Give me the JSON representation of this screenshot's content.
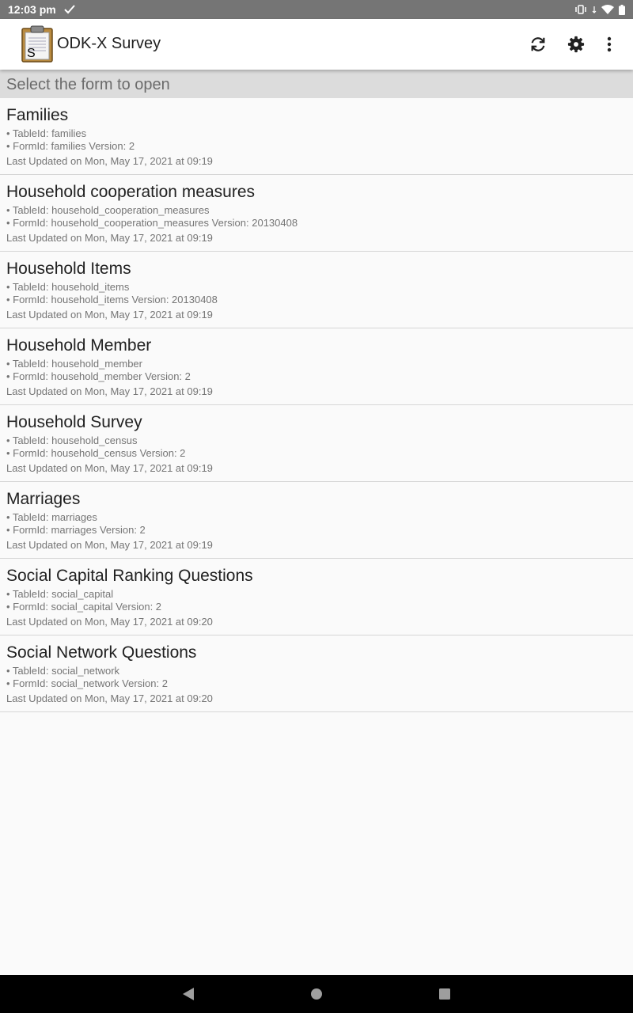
{
  "status": {
    "time": "12:03 pm"
  },
  "app": {
    "title": "ODK-X Survey",
    "logo_letter": "S"
  },
  "header": {
    "text": "Select the form to open"
  },
  "forms": [
    {
      "title": "Families",
      "table": "• TableId: families",
      "form": "• FormId: families Version: 2",
      "updated": "Last Updated on Mon, May 17, 2021 at 09:19"
    },
    {
      "title": "Household cooperation measures",
      "table": "• TableId: household_cooperation_measures",
      "form": "• FormId: household_cooperation_measures Version: 20130408",
      "updated": "Last Updated on Mon, May 17, 2021 at 09:19"
    },
    {
      "title": "Household Items",
      "table": "• TableId: household_items",
      "form": "• FormId: household_items Version: 20130408",
      "updated": "Last Updated on Mon, May 17, 2021 at 09:19"
    },
    {
      "title": "Household Member",
      "table": "• TableId: household_member",
      "form": "• FormId: household_member Version: 2",
      "updated": "Last Updated on Mon, May 17, 2021 at 09:19"
    },
    {
      "title": "Household Survey",
      "table": "• TableId: household_census",
      "form": "• FormId: household_census Version: 2",
      "updated": "Last Updated on Mon, May 17, 2021 at 09:19"
    },
    {
      "title": "Marriages",
      "table": "• TableId: marriages",
      "form": "• FormId: marriages Version: 2",
      "updated": "Last Updated on Mon, May 17, 2021 at 09:19"
    },
    {
      "title": "Social Capital Ranking Questions",
      "table": "• TableId: social_capital",
      "form": "• FormId: social_capital Version: 2",
      "updated": "Last Updated on Mon, May 17, 2021 at 09:20"
    },
    {
      "title": "Social Network Questions",
      "table": "• TableId: social_network",
      "form": "• FormId: social_network Version: 2",
      "updated": "Last Updated on Mon, May 17, 2021 at 09:20"
    }
  ],
  "icons": {
    "check": "check-icon",
    "vibrate": "vibrate-icon",
    "wifi": "wifi-icon",
    "battery": "battery-icon",
    "sync": "sync-icon",
    "settings": "gear-icon",
    "more": "more-vert-icon",
    "back": "back-icon",
    "home": "home-icon",
    "recents": "recents-icon"
  },
  "colors": {
    "appbar": "#ffffff",
    "statusbar": "#757575",
    "header_strip": "#dcdcdc",
    "background": "#fafafa",
    "navbar": "#000000"
  }
}
